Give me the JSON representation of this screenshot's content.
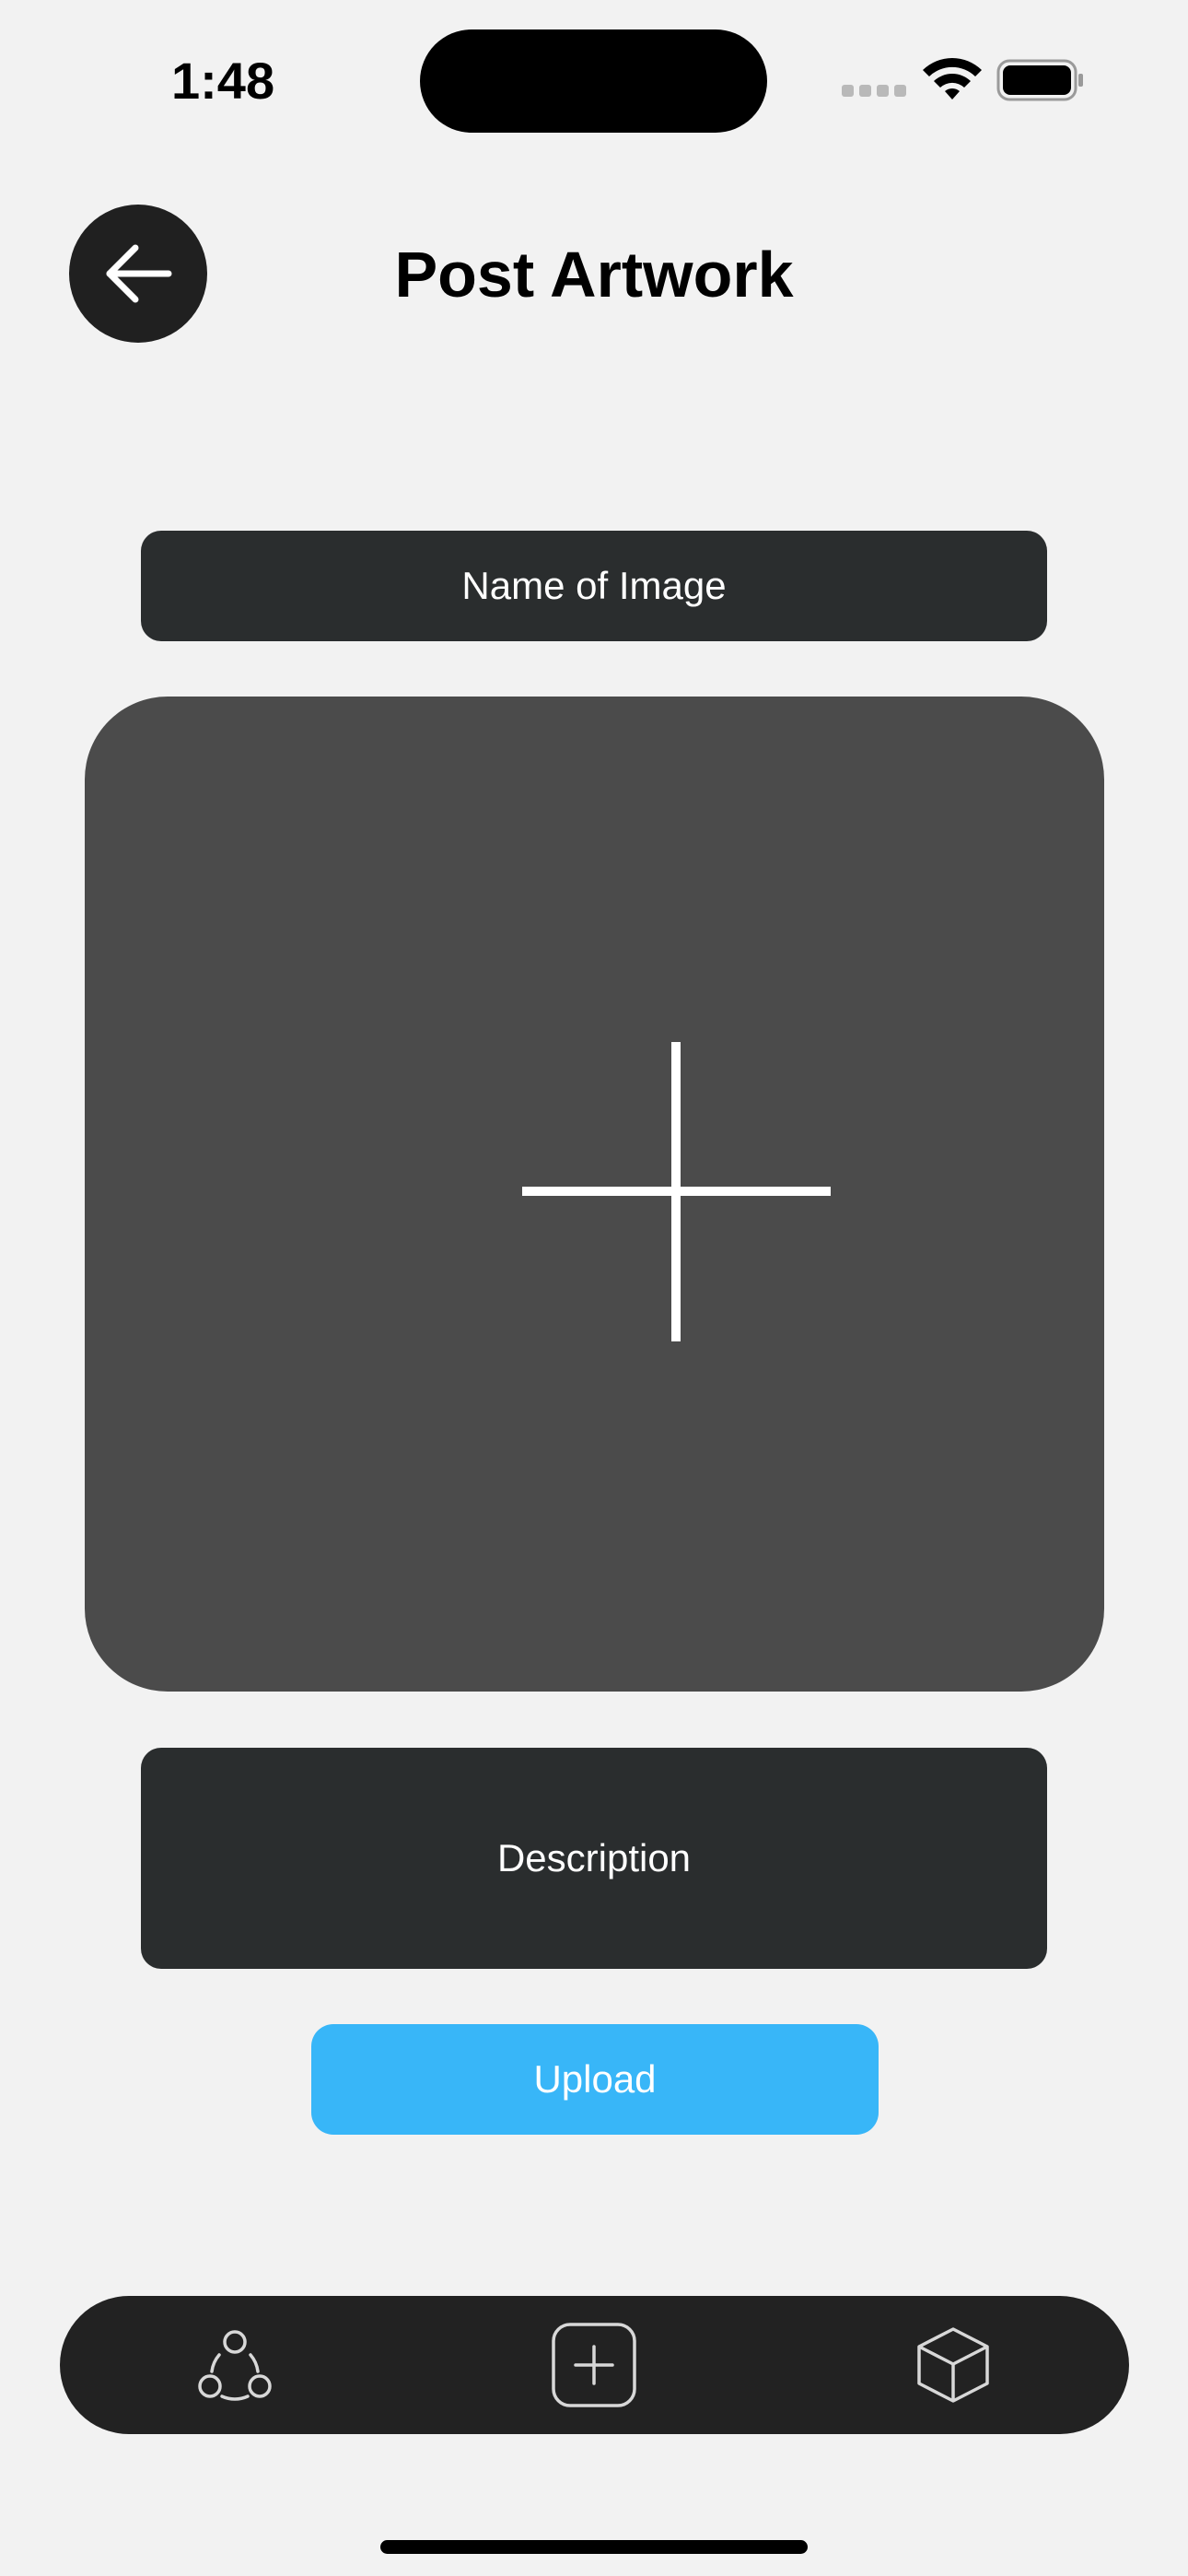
{
  "status_bar": {
    "time": "1:48"
  },
  "header": {
    "title": "Post Artwork",
    "back_icon": "arrow-left-icon"
  },
  "form": {
    "name_placeholder": "Name of Image",
    "image_picker_icon": "plus-icon",
    "description_placeholder": "Description",
    "upload_label": "Upload"
  },
  "tab_bar": {
    "items": [
      {
        "icon": "community-icon"
      },
      {
        "icon": "add-square-icon"
      },
      {
        "icon": "cube-icon"
      }
    ]
  },
  "colors": {
    "background": "#f2f2f2",
    "field": "#2a2d2e",
    "image_picker": "#4b4b4b",
    "accent": "#38b6f8",
    "tab_bar": "#222222"
  }
}
